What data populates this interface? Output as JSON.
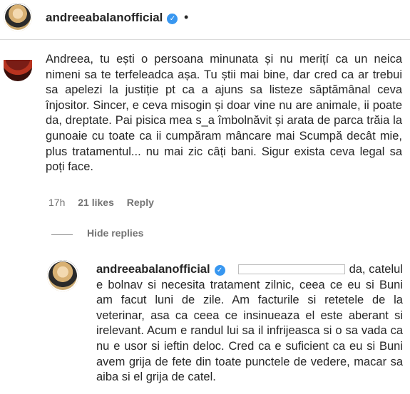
{
  "post": {
    "author": "andreeabalanofficial",
    "dot": "•"
  },
  "comment": {
    "text": "Andreea, tu ești o persoana minunata și nu merițí ca un neica nimeni sa te terfeleadca așa. Tu știi mai bine, dar cred ca ar trebui sa apelezi la justiție pt ca a ajuns sa listeze săptămânal ceva înjositor. Sincer, e ceva misogin și doar vine nu are animale, ii poate da, dreptate. Pai pisica mea s_a îmbolnăvit și arata de parca trăia la gunoaie cu toate ca ii cumpăram mâncare mai Scumpă decât mie, plus tratamentul... nu mai zic câți bani. Sigur exista ceva legal sa poți face.",
    "time": "17h",
    "likes": "21 likes",
    "reply": "Reply"
  },
  "replies": {
    "hide_label": "Hide replies",
    "items": [
      {
        "author": "andreeabalanofficial",
        "text_start": "da,",
        "text": "catelul e bolnav si necesita tratament zilnic, ceea ce eu si Buni am facut luni de zile. Am facturile si retetele de la veterinar, asa ca ceea ce insinueaza el este aberant si irelevant. Acum e randul lui sa il infrijeasca si o sa vada ca nu e usor si ieftin deloc. Cred ca e suficient ca eu si Buni avem grija de fete din toate punctele de vedere, macar sa aiba si el grija de catel."
      }
    ]
  },
  "colors": {
    "verified": "#3897f0",
    "secondary_text": "#737373"
  }
}
